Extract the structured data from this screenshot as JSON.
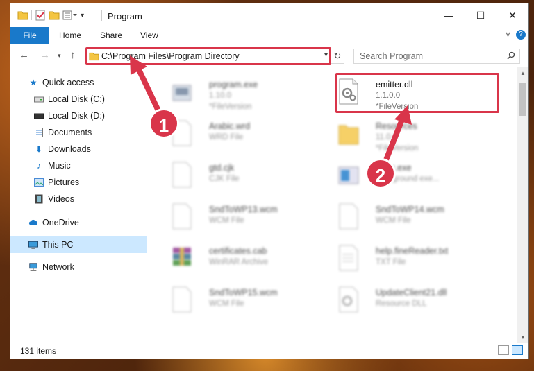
{
  "window": {
    "title": "Program",
    "controls": {
      "minimize": "—",
      "maximize": "☐",
      "close": "✕"
    }
  },
  "ribbon": {
    "tabs": [
      {
        "label": "File"
      },
      {
        "label": "Home"
      },
      {
        "label": "Share"
      },
      {
        "label": "View"
      }
    ],
    "expand": "˅",
    "help": "?"
  },
  "address": {
    "path": "C:\\Program Files\\Program Directory",
    "refresh": "↻"
  },
  "search": {
    "placeholder": "Search Program",
    "icon": "search-icon"
  },
  "sidebar": {
    "items": [
      {
        "label": "Quick access",
        "icon": "star-icon"
      },
      {
        "label": "Local Disk (C:)",
        "icon": "drive-icon",
        "pinned": true
      },
      {
        "label": "Local Disk (D:)",
        "icon": "drive-icon",
        "pinned": true
      },
      {
        "label": "Documents",
        "icon": "documents-icon",
        "pinned": true
      },
      {
        "label": "Downloads",
        "icon": "downloads-icon",
        "pinned": true
      },
      {
        "label": "Music",
        "icon": "music-icon",
        "pinned": true
      },
      {
        "label": "Pictures",
        "icon": "pictures-icon",
        "pinned": true
      },
      {
        "label": "Videos",
        "icon": "videos-icon",
        "pinned": true
      },
      {
        "label": "OneDrive",
        "icon": "cloud-icon"
      },
      {
        "label": "This PC",
        "icon": "computer-icon",
        "selected": true
      },
      {
        "label": "Network",
        "icon": "network-icon"
      }
    ]
  },
  "files": [
    {
      "name": "program.exe",
      "sub": "1.10.0",
      "sub2": "*FileVersion"
    },
    {
      "name": "emitter.dll",
      "sub": "1.1.0.0",
      "sub2": "*FileVersion"
    },
    {
      "name": "Arabic.wrd",
      "sub": "WRD File"
    },
    {
      "name": "Resources",
      "sub": "11.0.0",
      "sub2": "*FileVersion"
    },
    {
      "name": "gtd.cjk",
      "sub": "CJK File"
    },
    {
      "name": "Exec.exe",
      "sub": "background exe..."
    },
    {
      "name": "SndToWP13.wcm",
      "sub": "WCM File"
    },
    {
      "name": "SndToWP14.wcm",
      "sub": "WCM File"
    },
    {
      "name": "certificates.cab",
      "sub": "WinRAR Archive"
    },
    {
      "name": "help.fineReader.txt",
      "sub": "TXT File"
    },
    {
      "name": "SndToWP15.wcm",
      "sub": "WCM File"
    },
    {
      "name": "UpdateClient21.dll",
      "sub": "Resource DLL"
    }
  ],
  "status": {
    "count": "131 items"
  },
  "annotations": {
    "step1": "1",
    "step2": "2",
    "color": "#d9354a"
  }
}
